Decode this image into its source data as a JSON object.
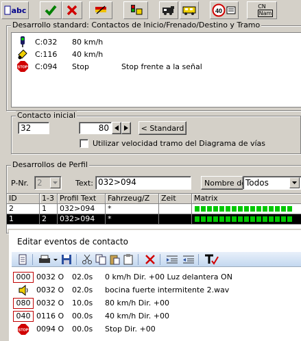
{
  "toolbar": {
    "abc_label": "abc",
    "signal_label_top": "CN",
    "signal_label_bottom": "Nam",
    "speed_label": "40"
  },
  "standard": {
    "title": "Desarrollo standard: Contactos de Inicio/Frenado/Destino y Tramo",
    "rows": [
      {
        "icon": "signal-icon",
        "contact": "C:032",
        "speed": "80 km/h",
        "note": ""
      },
      {
        "icon": "yellow-signal-icon",
        "contact": "C:116",
        "speed": "40 km/h",
        "note": ""
      },
      {
        "icon": "stop-icon",
        "contact": "C:094",
        "speed": "Stop",
        "note": "Stop frente a la señal"
      }
    ]
  },
  "contacto": {
    "title": "Contacto inicial",
    "contact_value": "32",
    "speed_value": "80",
    "standard_button": "< Standard",
    "checkbox_label": "Utilizar velocidad tramo del Diagrama de vías",
    "checkbox_checked": false
  },
  "perfil": {
    "title": "Desarrollos de Perfil",
    "pnr_label": "P-Nr.",
    "pnr_value": "2",
    "text_label": "Text:",
    "text_value": "032>094",
    "name_label": "Nombre de",
    "name_value": "Todos",
    "columns": [
      "ID",
      "1-3",
      "Profil Text",
      "Fahrzeug/Z",
      "Zeit",
      "Matrix"
    ],
    "rows": [
      {
        "id": "2",
        "n": "1",
        "text": "032>094",
        "vehicle": "*",
        "time": "",
        "selected": false
      },
      {
        "id": "1",
        "n": "2",
        "text": "032>094",
        "vehicle": "*",
        "time": "",
        "selected": true
      }
    ]
  },
  "editor": {
    "title": "Editar eventos de contacto",
    "events": [
      {
        "badge": "000",
        "icon": "",
        "contact": "0032 O",
        "time": "02.0s",
        "desc": "0 km/h Dir. +00 Luz delantera ON"
      },
      {
        "badge": "",
        "icon": "horn-icon",
        "contact": "0032 O",
        "time": "02.0s",
        "desc": "bocina fuerte intermitente 2.wav"
      },
      {
        "badge": "080",
        "icon": "",
        "contact": "0032 O",
        "time": "10.0s",
        "desc": "80 km/h Dir. +00"
      },
      {
        "badge": "040",
        "icon": "",
        "contact": "0116 O",
        "time": "00.0s",
        "desc": "40 km/h Dir. +00"
      },
      {
        "badge": "",
        "icon": "stop-icon",
        "contact": "0094 O",
        "time": "00.0s",
        "desc": "Stop Dir. +00"
      }
    ]
  },
  "colors": {
    "matrix_green": "#00c800",
    "badge_red": "#c00000"
  }
}
